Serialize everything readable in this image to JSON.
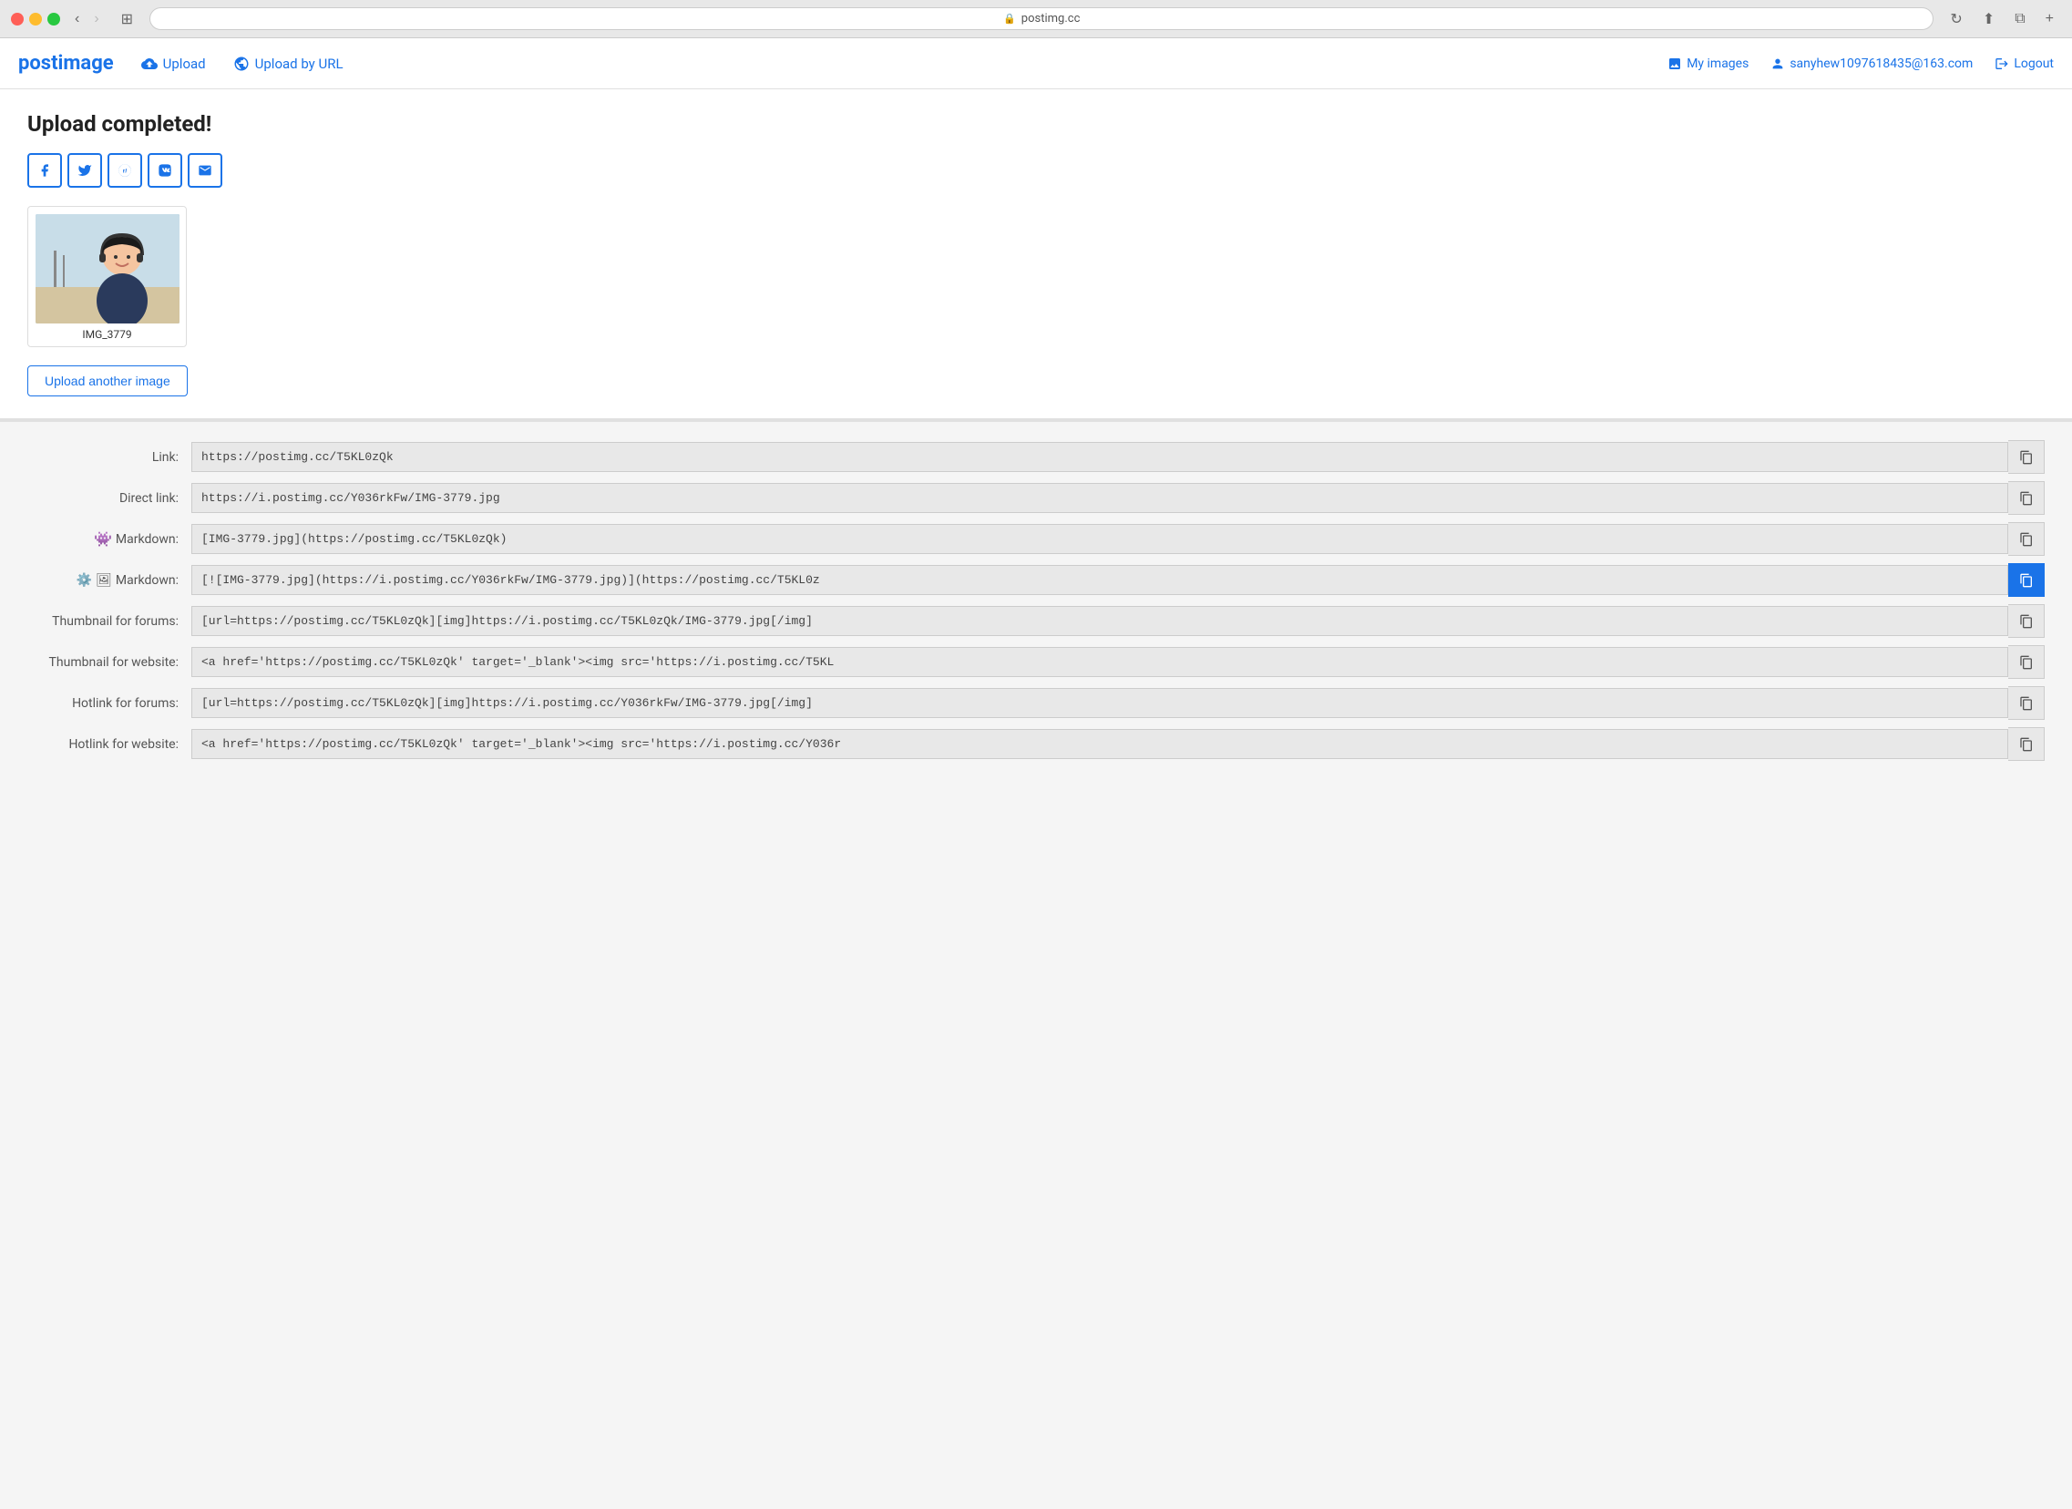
{
  "browser": {
    "url": "postimg.cc",
    "back_disabled": false,
    "forward_disabled": true
  },
  "header": {
    "logo_post": "post",
    "logo_image": "image",
    "upload_label": "Upload",
    "upload_by_url_label": "Upload by URL",
    "my_images_label": "My images",
    "user_email": "sanyhew1097618435@163.com",
    "logout_label": "Logout"
  },
  "upload_section": {
    "title": "Upload completed!",
    "image_name": "IMG_3779",
    "upload_another_label": "Upload another image"
  },
  "social": {
    "facebook": "f",
    "twitter": "t",
    "reddit": "r",
    "vk": "B",
    "email": "@"
  },
  "links": [
    {
      "label": "Link:",
      "icon": "",
      "value": "https://postimg.cc/T5KL0zQk",
      "copy_active": false
    },
    {
      "label": "Direct link:",
      "icon": "",
      "value": "https://i.postimg.cc/Y036rkFw/IMG-3779.jpg",
      "copy_active": false
    },
    {
      "label": "Markdown:",
      "icon": "reddit",
      "value": "[IMG-3779.jpg](https://postimg.cc/T5KL0zQk)",
      "copy_active": false
    },
    {
      "label": "Markdown:",
      "icon": "github-image",
      "value": "[![IMG-3779.jpg](https://i.postimg.cc/Y036rkFw/IMG-3779.jpg)](https://postimg.cc/T5KL0z",
      "copy_active": true
    },
    {
      "label": "Thumbnail for forums:",
      "icon": "",
      "value": "[url=https://postimg.cc/T5KL0zQk][img]https://i.postimg.cc/T5KL0zQk/IMG-3779.jpg[/img]",
      "copy_active": false
    },
    {
      "label": "Thumbnail for website:",
      "icon": "",
      "value": "<a href='https://postimg.cc/T5KL0zQk' target='_blank'><img src='https://i.postimg.cc/T5KL",
      "copy_active": false
    },
    {
      "label": "Hotlink for forums:",
      "icon": "",
      "value": "[url=https://postimg.cc/T5KL0zQk][img]https://i.postimg.cc/Y036rkFw/IMG-3779.jpg[/img]",
      "copy_active": false
    },
    {
      "label": "Hotlink for website:",
      "icon": "",
      "value": "<a href='https://postimg.cc/T5KL0zQk' target='_blank'><img src='https://i.postimg.cc/Y036r",
      "copy_active": false
    }
  ]
}
